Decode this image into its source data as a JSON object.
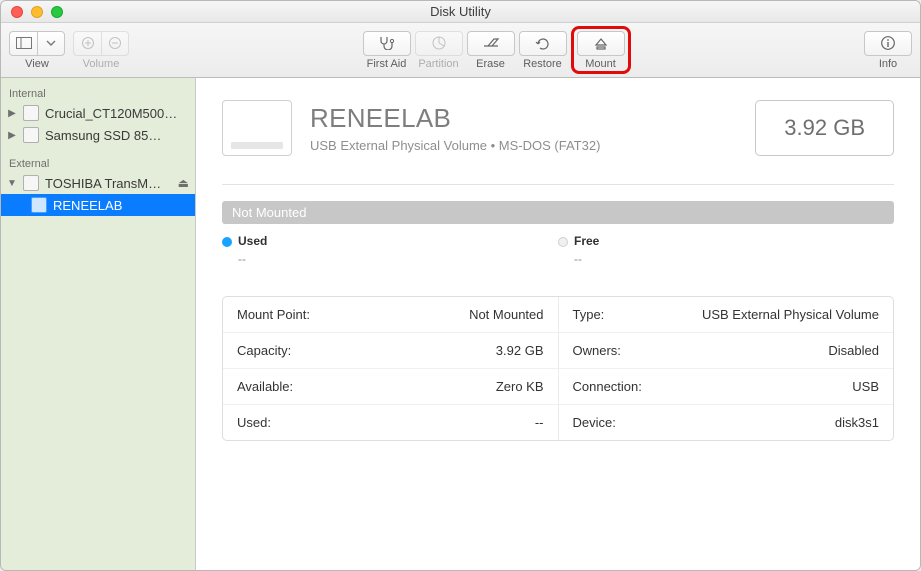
{
  "window": {
    "title": "Disk Utility"
  },
  "toolbar": {
    "view_label": "View",
    "volume_label": "Volume",
    "firstaid_label": "First Aid",
    "partition_label": "Partition",
    "erase_label": "Erase",
    "restore_label": "Restore",
    "mount_label": "Mount",
    "info_label": "Info"
  },
  "sidebar": {
    "internal_header": "Internal",
    "external_header": "External",
    "internal": [
      {
        "label": "Crucial_CT120M500…"
      },
      {
        "label": "Samsung SSD 85…"
      }
    ],
    "external_disk": "TOSHIBA TransM…",
    "external_volume": "RENEELAB"
  },
  "volume": {
    "name": "RENEELAB",
    "subtitle": "USB External Physical Volume • MS-DOS (FAT32)",
    "size": "3.92 GB",
    "status": "Not Mounted",
    "used_label": "Used",
    "used_value": "--",
    "free_label": "Free",
    "free_value": "--"
  },
  "info": {
    "left": [
      {
        "k": "Mount Point:",
        "v": "Not Mounted"
      },
      {
        "k": "Capacity:",
        "v": "3.92 GB"
      },
      {
        "k": "Available:",
        "v": "Zero KB"
      },
      {
        "k": "Used:",
        "v": "--"
      }
    ],
    "right": [
      {
        "k": "Type:",
        "v": "USB External Physical Volume"
      },
      {
        "k": "Owners:",
        "v": "Disabled"
      },
      {
        "k": "Connection:",
        "v": "USB"
      },
      {
        "k": "Device:",
        "v": "disk3s1"
      }
    ]
  }
}
